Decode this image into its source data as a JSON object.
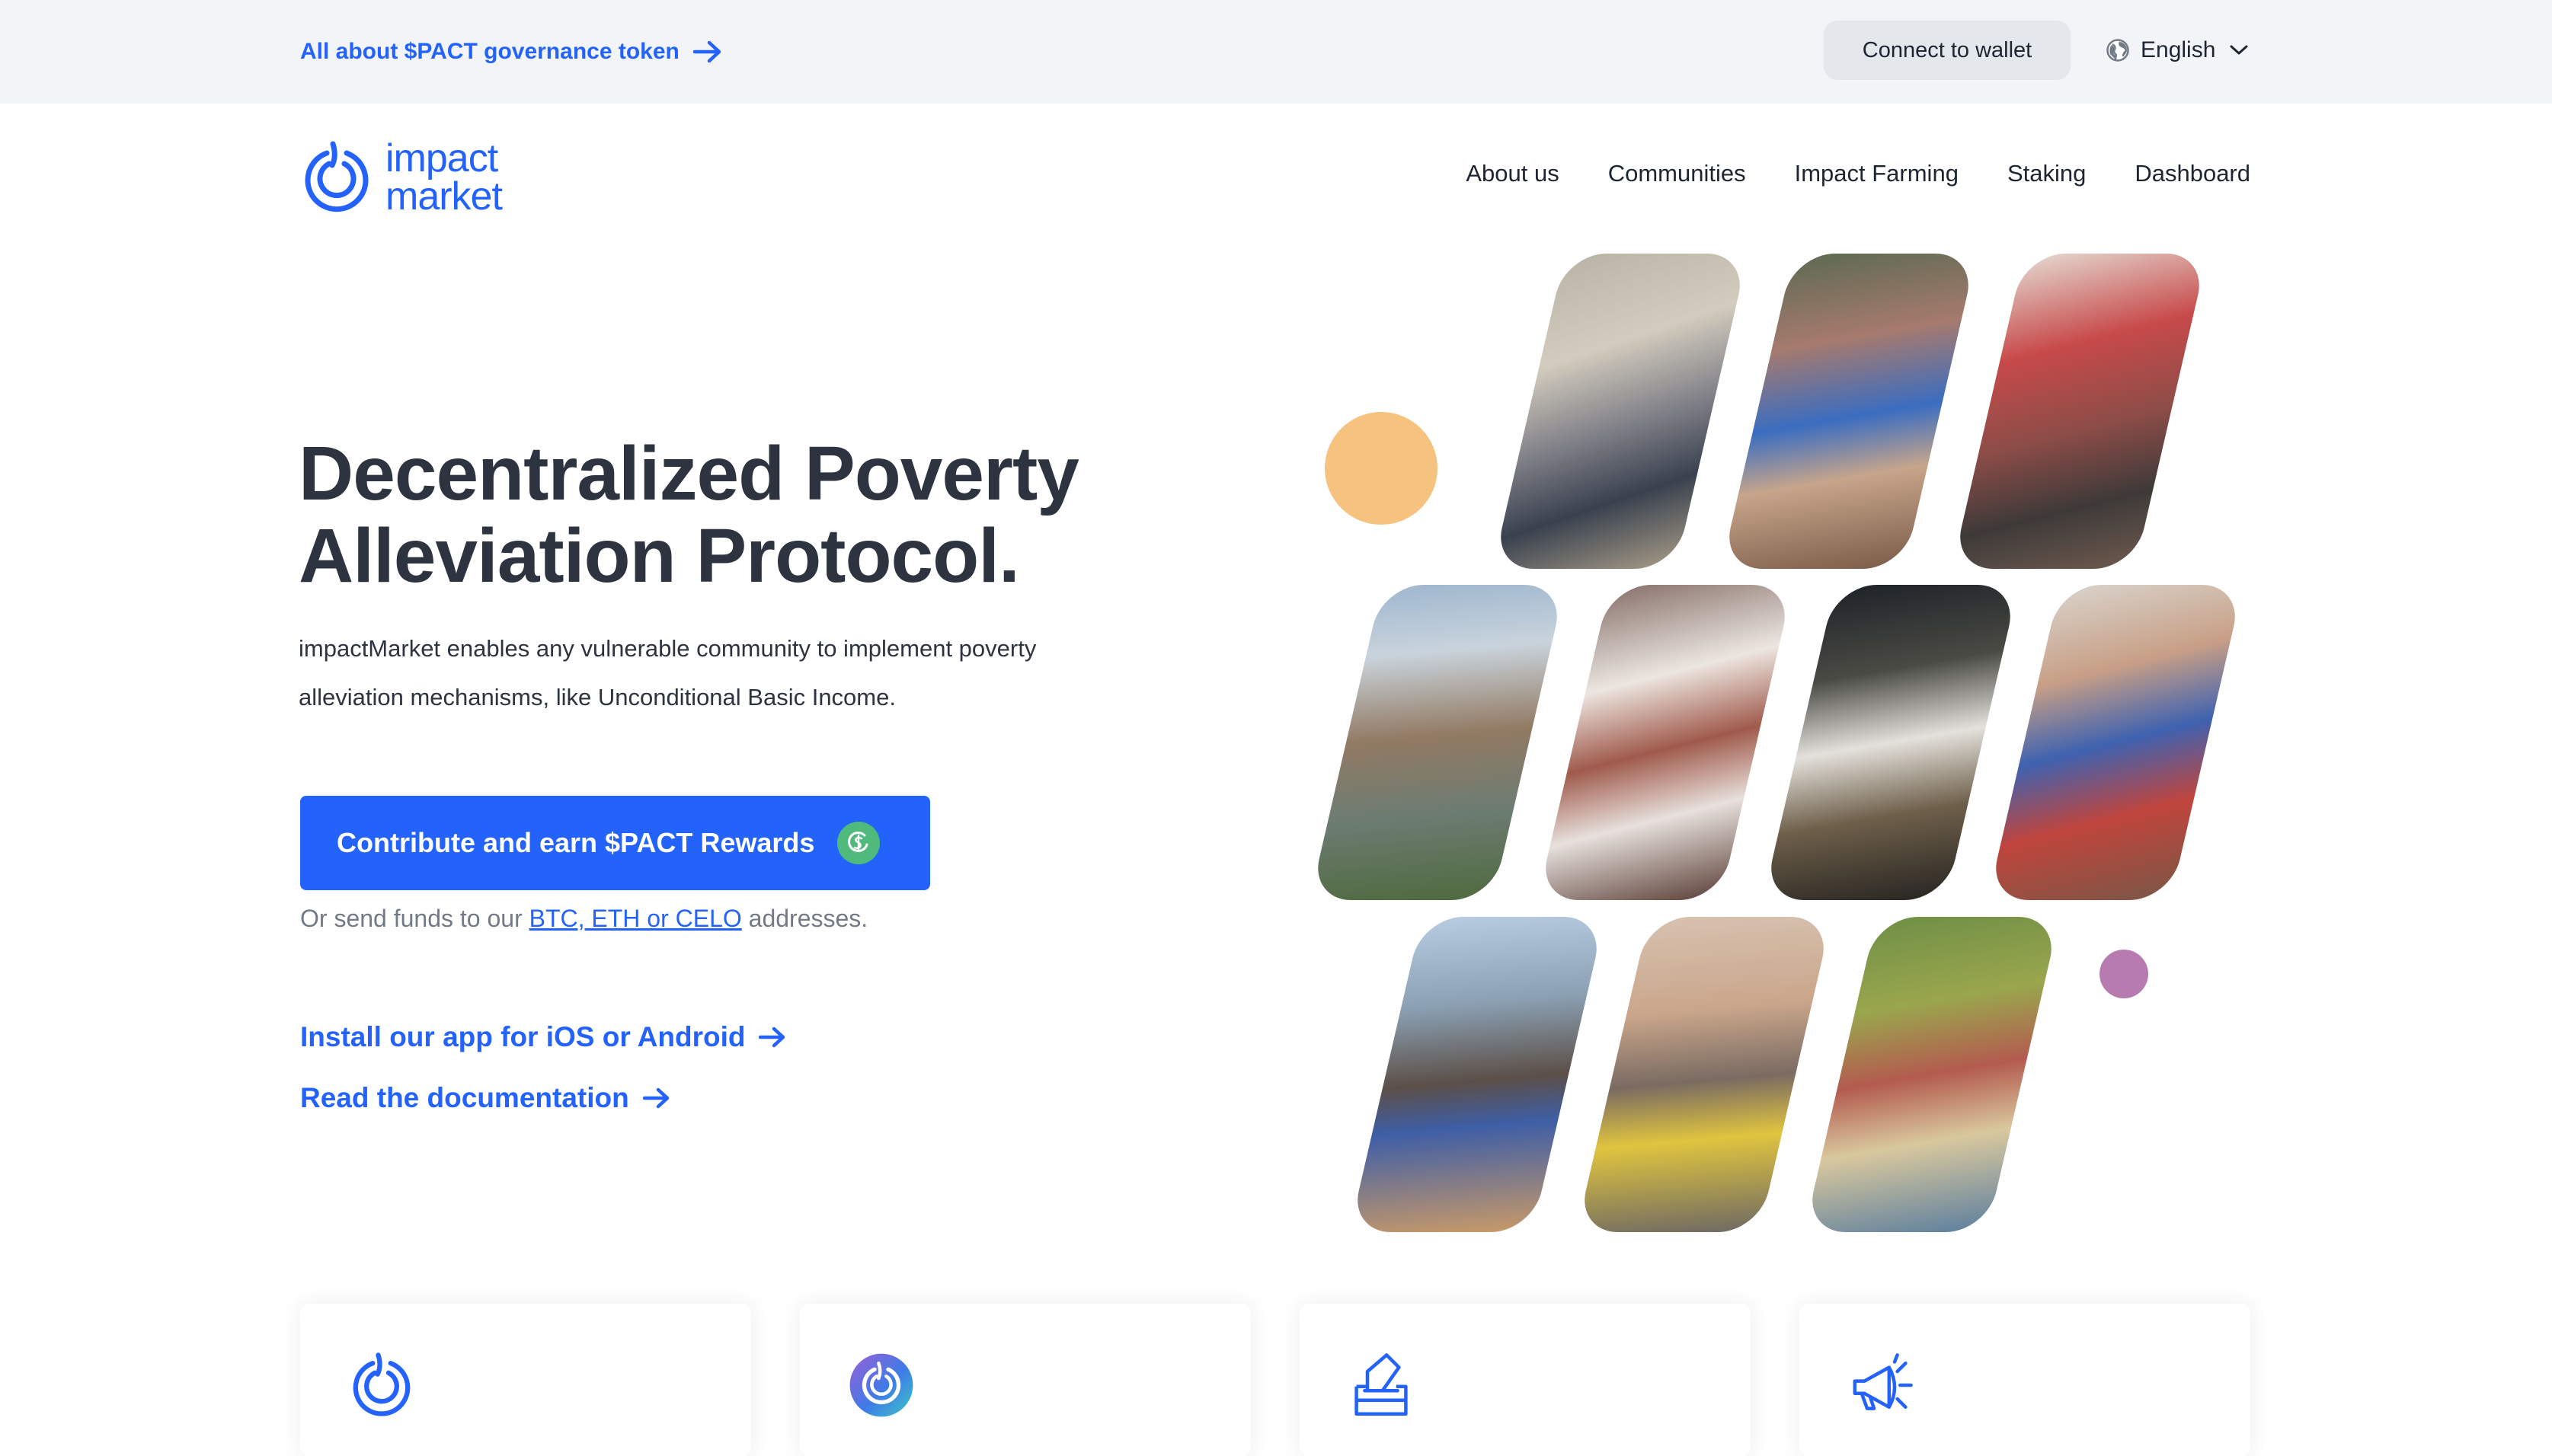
{
  "topbar": {
    "announcement": "All about $PACT governance token",
    "wallet_button": "Connect to wallet",
    "language": "English"
  },
  "header": {
    "logo_line1": "impact",
    "logo_line2": "market",
    "nav": [
      "About us",
      "Communities",
      "Impact Farming",
      "Staking",
      "Dashboard"
    ]
  },
  "hero": {
    "title_line1": "Decentralized Poverty",
    "title_line2": "Alleviation Protocol.",
    "description_line1": "impactMarket enables any vulnerable community to implement poverty",
    "description_line2": "alleviation mechanisms, like Unconditional Basic Income.",
    "cta_label": "Contribute and earn $PACT Rewards",
    "send_prefix": "Or send funds to our",
    "send_link": "BTC, ETH or CELO",
    "send_suffix": "addresses.",
    "install_link": "Install our app for iOS or Android",
    "docs_link": "Read the documentation"
  },
  "colors": {
    "brand_blue": "#2362fb",
    "cta_coin_green": "#4fba7b",
    "deco_orange": "#f6c27f",
    "deco_purple": "#b77bb0",
    "topbar_bg": "#f2f4f7"
  },
  "collage": {
    "photos": [
      "community-photo-1",
      "community-photo-2",
      "community-photo-3",
      "community-photo-4",
      "community-photo-5",
      "community-photo-6",
      "community-photo-7",
      "community-photo-8",
      "community-photo-9",
      "community-photo-10"
    ]
  },
  "cards": [
    {
      "icon": "impact-logo-icon"
    },
    {
      "icon": "pact-token-icon"
    },
    {
      "icon": "ballot-box-icon"
    },
    {
      "icon": "megaphone-icon"
    }
  ]
}
